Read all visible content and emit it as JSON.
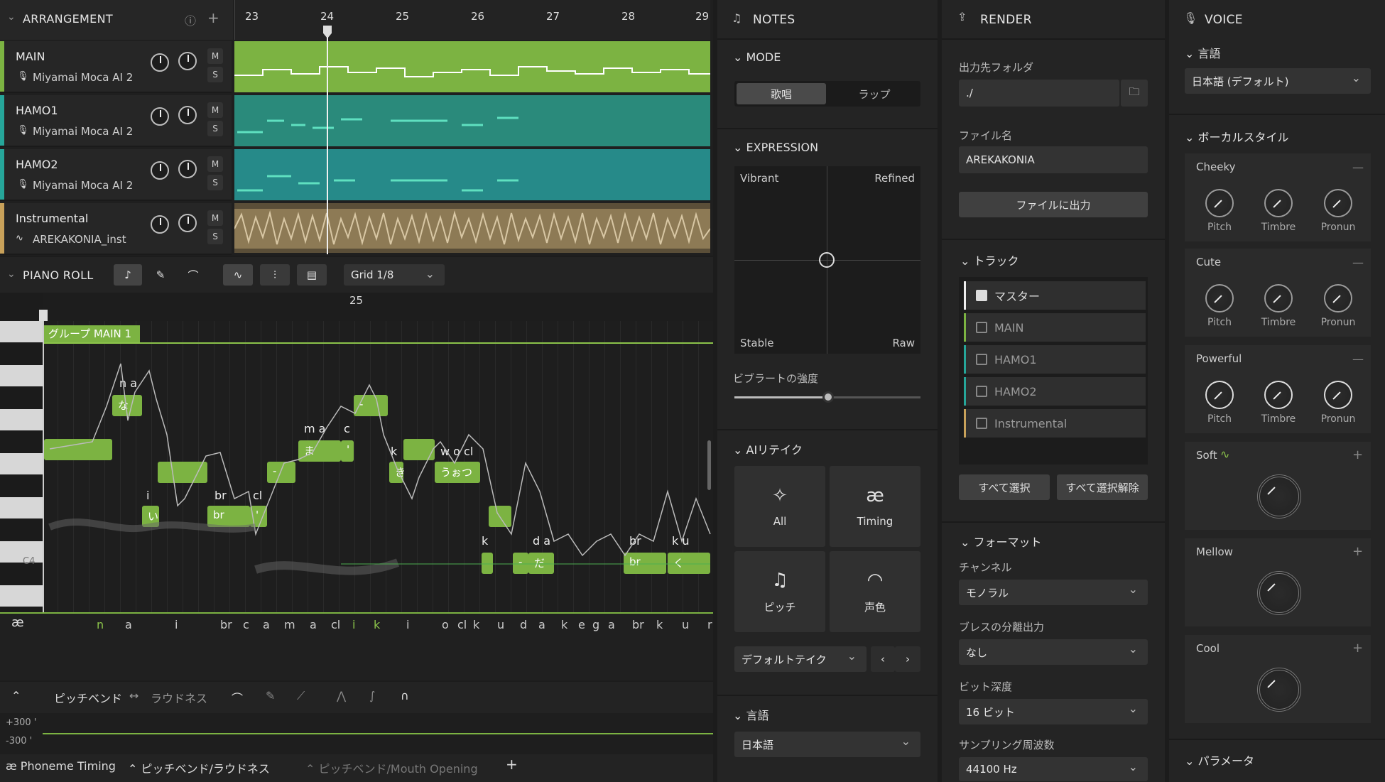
{
  "arrangement": {
    "title": "ARRANGEMENT",
    "ruler": [
      "23",
      "24",
      "25",
      "26",
      "27",
      "28",
      "29"
    ],
    "tracks": [
      {
        "name": "MAIN",
        "sub": "Miyamai Moca AI 2",
        "color": "#7cb342"
      },
      {
        "name": "HAMO1",
        "sub": "Miyamai Moca AI 2",
        "color": "#26a69a"
      },
      {
        "name": "HAMO2",
        "sub": "Miyamai Moca AI 2",
        "color": "#26a69a"
      },
      {
        "name": "Instrumental",
        "sub": "AREKAKONIA_inst",
        "color": "#c8a15a"
      }
    ],
    "m": "M",
    "s": "S"
  },
  "pianoroll": {
    "title": "PIANO ROLL",
    "grid": "Grid 1/8",
    "bar": "25",
    "group": "グループ MAIN 1",
    "c4": "C4",
    "notes": [
      "な",
      "い",
      "br",
      "'",
      "-",
      "ま",
      "'",
      "-",
      "き",
      "うぉつ",
      "-",
      "だ",
      "br",
      "く"
    ],
    "lyrics": [
      "n a",
      "i",
      "br",
      "cl",
      "m a",
      "c",
      "k",
      "w o cl",
      "k",
      "d a",
      "br",
      "k u"
    ],
    "phonemes": [
      "n",
      "a",
      "i",
      "br",
      "c",
      "a",
      "m",
      "a",
      "cl",
      "i",
      "k",
      "i",
      "o",
      "cl",
      "k",
      "u",
      "d",
      "a",
      "k",
      "e",
      "g",
      "a",
      "br",
      "k",
      "u",
      "r"
    ]
  },
  "pitch": {
    "label": "ピッチベンド",
    "arrow": "↔",
    "label2": "ラウドネス",
    "p300": "+300 '",
    "m300": "-300 '"
  },
  "tabs": [
    "Phoneme Timing",
    "ピッチベンド/ラウドネス",
    "ピッチベンド/Mouth Opening",
    "+"
  ],
  "notes": {
    "title": "NOTES",
    "mode": "MODE",
    "modes": [
      "歌唱",
      "ラップ"
    ],
    "expression": "EXPRESSION",
    "xy": [
      "Vibrant",
      "Refined",
      "Stable",
      "Raw"
    ],
    "vib": "ビブラートの強度",
    "retake": "AIリテイク",
    "retake_btns": [
      "All",
      "Timing",
      "ピッチ",
      "声色"
    ],
    "take": "デフォルトテイク",
    "lang": "言語",
    "lang_val": "日本語"
  },
  "render": {
    "title": "RENDER",
    "folder_label": "出力先フォルダ",
    "folder": "./",
    "file_label": "ファイル名",
    "file": "AREKAKONIA",
    "export": "ファイルに出力",
    "track": "トラック",
    "tracks": [
      "マスター",
      "MAIN",
      "HAMO1",
      "HAMO2",
      "Instrumental"
    ],
    "sel_all": "すべて選択",
    "desel": "すべて選択解除",
    "format": "フォーマット",
    "ch_label": "チャンネル",
    "ch": "モノラル",
    "br_label": "ブレスの分離出力",
    "br": "なし",
    "bit_label": "ビット深度",
    "bit": "16 ビット",
    "sr_label": "サンプリング周波数",
    "sr": "44100 Hz"
  },
  "voice": {
    "title": "VOICE",
    "lang": "言語",
    "lang_val": "日本語 (デフォルト)",
    "style": "ボーカルスタイル",
    "styles": [
      "Cheeky",
      "Cute",
      "Powerful",
      "Soft",
      "Mellow",
      "Cool"
    ],
    "knobs": [
      "Pitch",
      "Timbre",
      "Pronun"
    ],
    "param": "パラメータ",
    "minus": "—",
    "plus": "+"
  }
}
